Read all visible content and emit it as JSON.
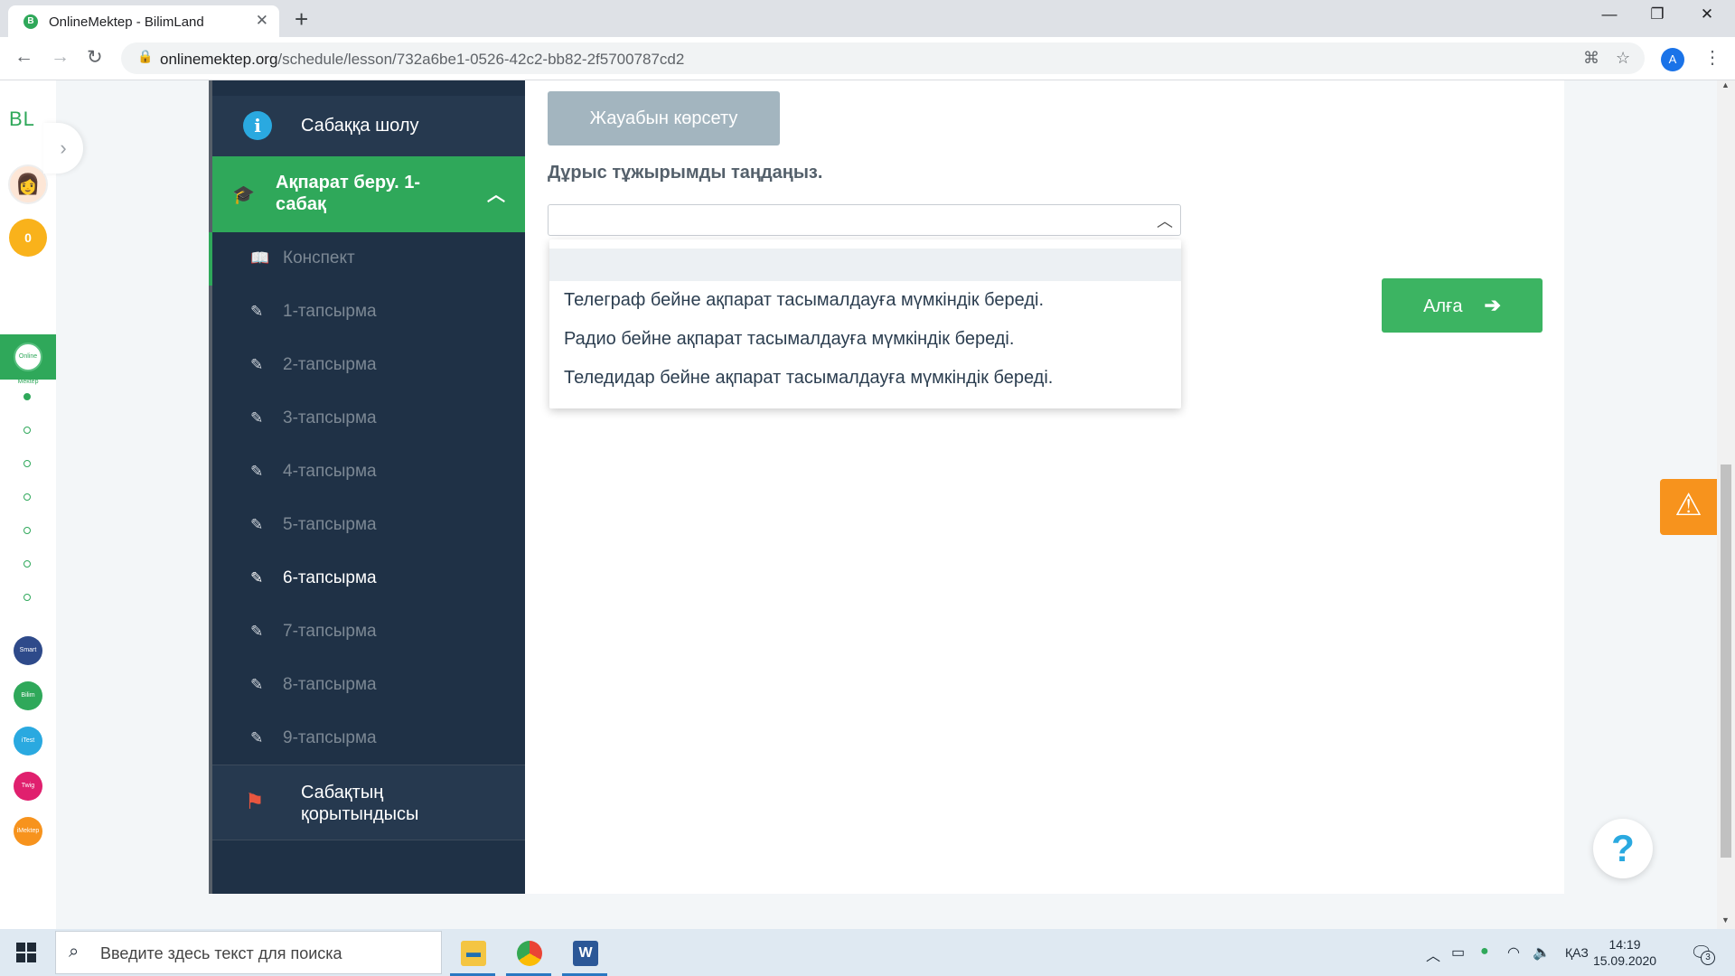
{
  "browser": {
    "tab_title": "OnlineMektep - BilimLand",
    "favicon": "B",
    "close": "✕",
    "new_tab": "+",
    "url_host": "onlinemektep.org",
    "url_path": "/schedule/lesson/732a6be1-0526-42c2-bb82-2f5700787cd2",
    "profile_initial": "A",
    "controls": {
      "minimize": "—",
      "maximize": "❐",
      "close": "✕"
    }
  },
  "rail": {
    "logo": "BL",
    "coins": "0",
    "active_app": "Online Mektep",
    "apps": [
      {
        "label": "Smart Nation",
        "color": "#2e4a8a"
      },
      {
        "label": "Bilim Land",
        "color": "#2fa85a"
      },
      {
        "label": "iTest",
        "color": "#2aa9e0"
      },
      {
        "label": "Twig",
        "color": "#e0206e"
      },
      {
        "label": "iMektep",
        "color": "#f7931d"
      }
    ]
  },
  "nav": {
    "overview": "Сабаққа шолу",
    "section": "Ақпарат беру. 1-сабақ",
    "items": [
      {
        "label": "Конспект",
        "icon": "book-icon"
      },
      {
        "label": "1-тапсырма",
        "icon": "edit-icon"
      },
      {
        "label": "2-тапсырма",
        "icon": "edit-icon"
      },
      {
        "label": "3-тапсырма",
        "icon": "edit-icon"
      },
      {
        "label": "4-тапсырма",
        "icon": "edit-icon"
      },
      {
        "label": "5-тапсырма",
        "icon": "edit-icon"
      },
      {
        "label": "6-тапсырма",
        "icon": "edit-icon",
        "current": true
      },
      {
        "label": "7-тапсырма",
        "icon": "edit-icon"
      },
      {
        "label": "8-тапсырма",
        "icon": "edit-icon"
      },
      {
        "label": "9-тапсырма",
        "icon": "edit-icon"
      }
    ],
    "summary": "Сабақтың қорытындысы"
  },
  "content": {
    "show_answer_label": "Жауабын көрсету",
    "question": "Дұрыс тұжырымды таңдаңыз.",
    "select_value": "",
    "options": [
      "",
      "Телеграф бейне ақпарат тасымалдауға мүмкіндік береді.",
      "Радио бейне ақпарат тасымалдауға мүмкіндік береді.",
      "Теледидар бейне ақпарат тасымалдауға мүмкіндік береді."
    ],
    "next_label": "Алға",
    "help": "?"
  },
  "taskbar": {
    "search_placeholder": "Введите здесь текст для поиска",
    "language": "ҚАЗ",
    "time": "14:19",
    "date": "15.09.2020",
    "notifications": "3"
  },
  "colors": {
    "accent_green": "#2fa85a",
    "nav_bg": "#1f3146",
    "warning_orange": "#f7931d",
    "info_blue": "#2aa9e0"
  }
}
